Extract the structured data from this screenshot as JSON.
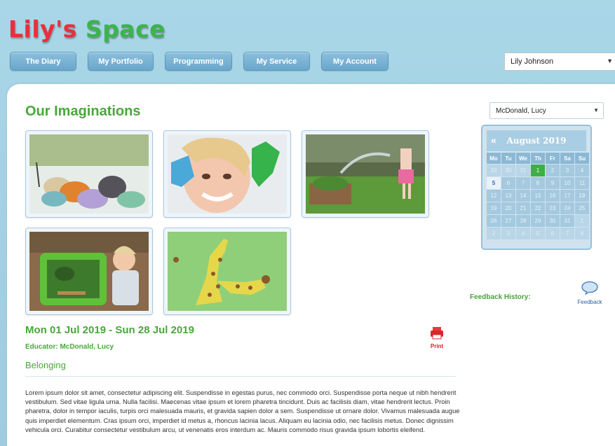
{
  "brand": {
    "part1": "Lily's",
    "part2": "Space"
  },
  "nav": [
    {
      "label": "The Diary"
    },
    {
      "label": "My Portfolio"
    },
    {
      "label": "Programming"
    },
    {
      "label": "My Service"
    },
    {
      "label": "My Account"
    }
  ],
  "user_select": {
    "value": "Lily Johnson"
  },
  "page": {
    "title": "Our Imaginations"
  },
  "child_select": {
    "value": "McDonald, Lucy"
  },
  "gallery": [
    {
      "subject": "painted rocks"
    },
    {
      "subject": "child with painted hands"
    },
    {
      "subject": "girl watering garden"
    },
    {
      "subject": "toddler playing in tub"
    },
    {
      "subject": "handprint giraffe painting"
    }
  ],
  "calendar": {
    "prev": "«",
    "month_label": "August 2019",
    "days_of_week": [
      "Mo",
      "Tu",
      "We",
      "Th",
      "Fr",
      "Sa",
      "Su"
    ],
    "weeks": [
      [
        "29",
        "30",
        "31",
        "1",
        "2",
        "3",
        "4"
      ],
      [
        "5",
        "6",
        "7",
        "8",
        "9",
        "10",
        "11"
      ],
      [
        "12",
        "13",
        "14",
        "15",
        "16",
        "17",
        "18"
      ],
      [
        "19",
        "20",
        "21",
        "22",
        "23",
        "24",
        "25"
      ],
      [
        "26",
        "27",
        "28",
        "29",
        "30",
        "31",
        "1"
      ],
      [
        "2",
        "3",
        "4",
        "5",
        "6",
        "7",
        "8"
      ]
    ],
    "today": "1",
    "selected": "5",
    "colors": {
      "today": "#3cb044",
      "day": "#a5c9df",
      "header": "#a9cde3"
    }
  },
  "feedback": {
    "label": "Feedback History:",
    "link_text": "Feedback"
  },
  "entry": {
    "period": "Mon 01 Jul 2019 - Sun 28 Jul 2019",
    "educator": "Educator: McDonald, Lucy",
    "category": "Belonging",
    "print_label": "Print",
    "body": "Lorem ipsum dolor sit amet, consectetur adipiscing elit. Suspendisse in egestas purus, nec commodo orci. Suspendisse porta neque ut nibh hendrerit vestibulum. Sed vitae ligula urna. Nulla facilisi. Maecenas vitae ipsum et lorem pharetra tincidunt. Duis ac facilisis diam, vitae hendrerit lectus. Proin pharetra, dolor in tempor iaculis, turpis orci malesuada mauris, et gravida sapien dolor a sem. Suspendisse ut ornare dolor. Vivamus malesuada augue quis imperdiet elementum. Cras ipsum orci, imperdiet id metus a, rhoncus lacinia lacus. Aliquam eu lacinia odio, nec facilisis metus. Donec dignissim vehicula orci. Curabitur consectetur vestibulum arcu, ut venenatis eros interdum ac. Mauris commodo risus gravida ipsum lobortis eleifend."
  },
  "theme": {
    "accent": "#48a83a",
    "brand_red": "#e8303c",
    "brand_green": "#3cb44a",
    "header_bg": "#a9d7e8"
  }
}
